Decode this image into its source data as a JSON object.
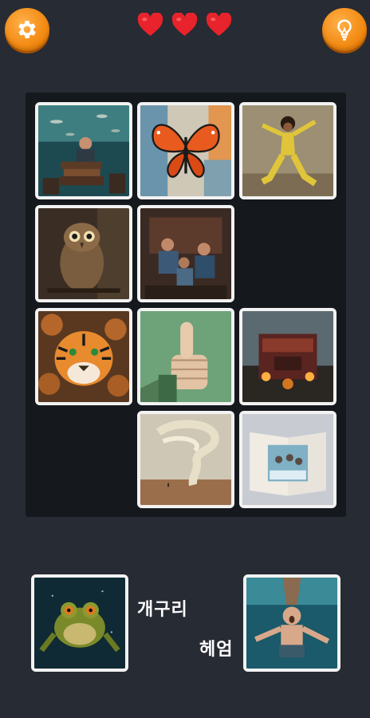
{
  "header": {
    "settings_icon": "gear-icon",
    "hint_icon": "lightbulb-icon",
    "lives": 3,
    "heart_color": "#e8232b",
    "button_color": "#f28a12"
  },
  "board": {
    "tiles": [
      {
        "icon": "man-reading-underwater-image"
      },
      {
        "icon": "butterfly-image"
      },
      {
        "icon": "dancing-woman-image"
      },
      {
        "icon": "owl-image"
      },
      {
        "icon": "mechanics-working-image"
      },
      {
        "icon": "tiger-image"
      },
      {
        "icon": "thumbs-up-image"
      },
      {
        "icon": "burning-truck-image"
      },
      {
        "icon": "tornado-image"
      },
      {
        "icon": "open-book-image"
      }
    ]
  },
  "words": {
    "left": {
      "label": "개구리",
      "icon": "frog-image"
    },
    "right": {
      "label": "헤엄",
      "icon": "swimming-woman-image"
    }
  }
}
